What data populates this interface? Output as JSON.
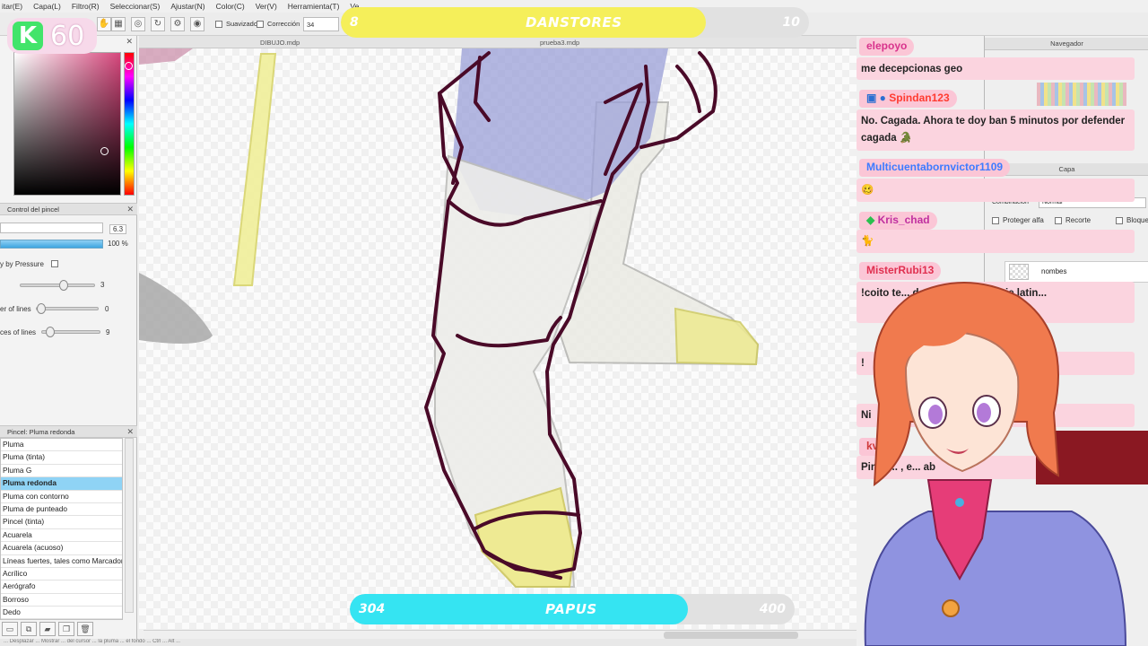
{
  "menu": [
    "itar(E)",
    "Capa(L)",
    "Filtro(R)",
    "Seleccionar(S)",
    "Ajustar(N)",
    "Color(C)",
    "Ver(V)",
    "Herramienta(T)",
    "Ve..."
  ],
  "toolbar": {
    "smoothing_label": "Suavizado",
    "correction_label": "Corrección",
    "correction_value": "34"
  },
  "doc_tabs": [
    "DIBUJO.mdp",
    "prueba3.mdp"
  ],
  "left": {
    "brush_control_title": "Control del pincel",
    "size_value": "6.3",
    "opacity_value": "100 %",
    "pressure_label": "y by Pressure",
    "slider1_value": "3",
    "slider2_label": "er of lines",
    "slider2_value": "0",
    "slider3_label": "ces of lines",
    "slider3_value": "9",
    "brush_panel_title": "Pincel: Pluma redonda",
    "brushes": [
      "Pluma",
      "Pluma (tinta)",
      "Pluma G",
      "Pluma redonda",
      "Pluma con contorno",
      "Pluma de punteado",
      "Pincel (tinta)",
      "Acuarela",
      "Acuarela (acuoso)",
      "Líneas fuertes, tales como Marcador",
      "Acrílico",
      "Aerógrafo",
      "Borroso",
      "Dedo"
    ],
    "selected_brush_index": 3
  },
  "right": {
    "navigator_title": "Navegador",
    "layer_title": "Capa",
    "blend_label": "Combinación",
    "blend_value": "Normal",
    "protect_alpha": "Proteger alfa",
    "clip": "Recorte",
    "lock": "Bloque",
    "layer_name": "nombes"
  },
  "overlay": {
    "kick_letter": "K",
    "kick_count": "60",
    "goal_top": {
      "start": "8",
      "name": "DANSTORES",
      "end": "10",
      "progress": 0.78,
      "color": "#f5ef5a"
    },
    "goal_bottom": {
      "start": "304",
      "name": "PAPUS",
      "end": "400",
      "progress": 0.76,
      "color": "#35e4f2"
    }
  },
  "chat": [
    {
      "user": "elepoyo",
      "user_color": "#d8338c",
      "message": "me decepcionas geo"
    },
    {
      "user": "Spindan123",
      "user_color": "#ff3b30",
      "message": "No. Cagada. Ahora te doy ban 5 minutos por defender cagada 🐊"
    },
    {
      "user": "Multicuentabornvictor1109",
      "user_color": "#3d7bff",
      "message": "🥴"
    },
    {
      "user": "Kris_chad",
      "user_color": "#c030a0",
      "message": "🐈"
    },
    {
      "user": "MisterRubi13",
      "user_color": "#e03050",
      "message": "!coito te... do ...eas con doblaje latin..."
    },
    {
      "user": "",
      "user_color": "#e03050",
      "message": "!"
    },
    {
      "user": "",
      "user_color": "#e03050",
      "message": "Ni"
    },
    {
      "user": "kv",
      "user_color": "#d03a3a",
      "message": "Pinch... , e... ab"
    }
  ],
  "status_text": "... Desplazar ... Mostrar ... del cursor ... la pluma ... el fondo ... Ctrl ... Alt ...",
  "colors": {
    "accent_blue": "#8fd3f5",
    "chat_bg": "#fbd4df",
    "kick_green": "#42e46a",
    "ink": "#4a0a28"
  }
}
